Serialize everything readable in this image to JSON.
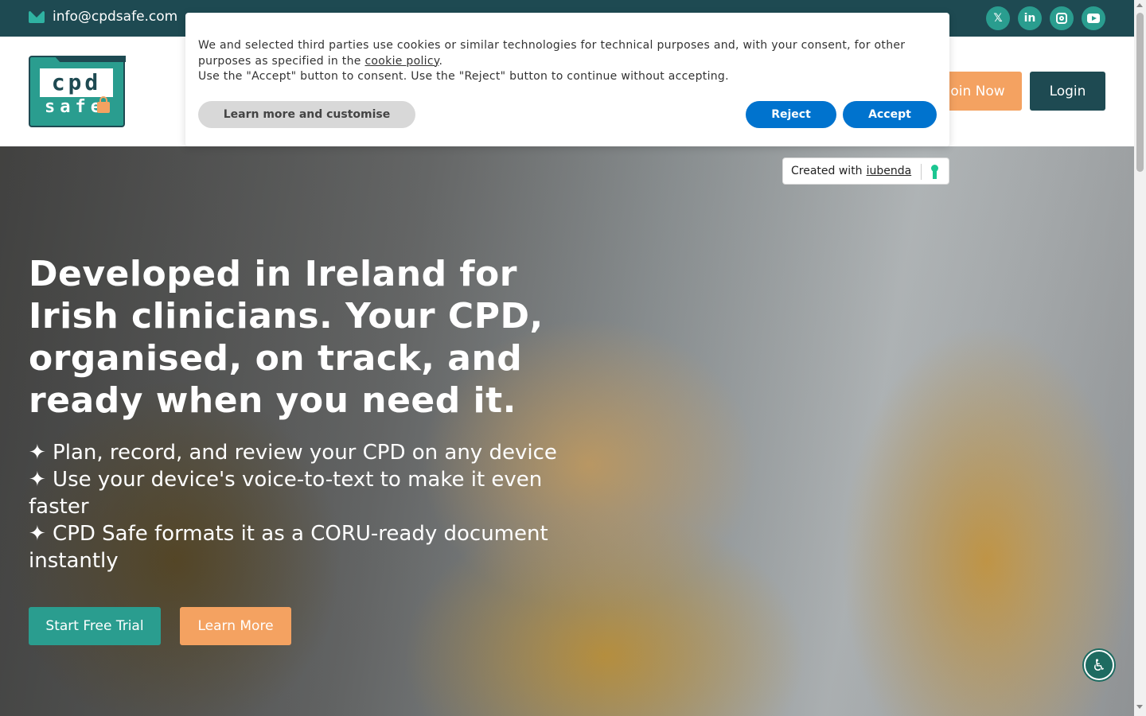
{
  "topbar": {
    "email": "info@cpdsafe.com",
    "social": [
      {
        "icon": "x-icon",
        "glyph": "𝕏"
      },
      {
        "icon": "linkedin-icon",
        "glyph": "in"
      },
      {
        "icon": "instagram-icon",
        "glyph": ""
      },
      {
        "icon": "youtube-icon",
        "glyph": ""
      }
    ]
  },
  "header": {
    "logo_top": "cpd",
    "logo_bottom": "safe",
    "join_label": "Join Now",
    "login_label": "Login"
  },
  "hero": {
    "headline": "Developed in Ireland for Irish clinicians. Your CPD, organised, on track, and ready when you need it.",
    "bullets": [
      "✦ Plan, record, and review your CPD on any device",
      "✦ Use your device's voice-to-text to make it even faster",
      "✦ CPD Safe formats it as a CORU-ready document instantly"
    ],
    "trial_label": "Start Free Trial",
    "learn_label": "Learn More"
  },
  "cookie": {
    "line1_a": "We and selected third parties use cookies or similar technologies for technical purposes and, with your consent, for other purposes as specified in the ",
    "link": "cookie policy",
    "line1_b": ".",
    "line2": "Use the \"Accept\" button to consent. Use the \"Reject\" button to continue without accepting.",
    "customise_label": "Learn more and customise",
    "reject_label": "Reject",
    "accept_label": "Accept"
  },
  "iubenda": {
    "prefix": "Created with",
    "brand": "iubenda"
  },
  "colors": {
    "dark": "#1e4a52",
    "teal": "#2a9d8f",
    "orange": "#f4a261",
    "blue": "#0073ce"
  }
}
